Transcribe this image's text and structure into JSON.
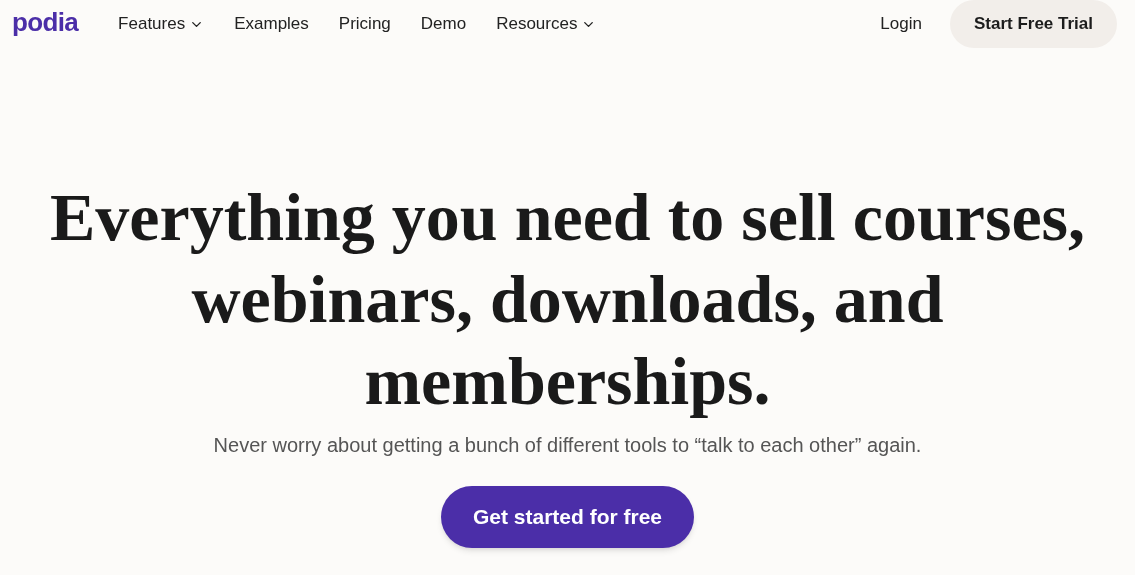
{
  "nav": {
    "logo": "podia",
    "items": [
      {
        "label": "Features",
        "dropdown": true
      },
      {
        "label": "Examples",
        "dropdown": false
      },
      {
        "label": "Pricing",
        "dropdown": false
      },
      {
        "label": "Demo",
        "dropdown": false
      },
      {
        "label": "Resources",
        "dropdown": true
      }
    ],
    "login": "Login",
    "cta": "Start Free Trial"
  },
  "hero": {
    "headline_lines": [
      "Everything you need to sell courses,",
      "webinars, downloads, and",
      "memberships."
    ],
    "subtitle": "Never worry about getting a bunch of different tools to “talk to each other” again.",
    "button": "Get started for free"
  }
}
